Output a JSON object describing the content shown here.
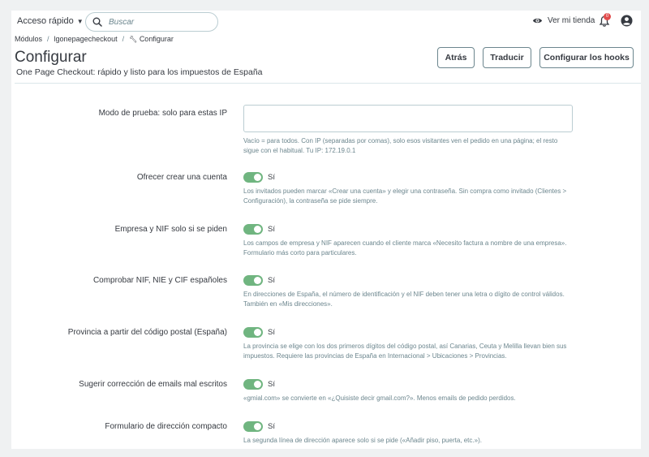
{
  "topbar": {
    "quick_access": "Acceso rápido",
    "search_placeholder": "Buscar",
    "store_link": "Ver mi tienda",
    "notification_count": "0"
  },
  "breadcrumb": {
    "items": [
      "Módulos",
      "lgonepagecheckout",
      "Configurar"
    ]
  },
  "header": {
    "title": "Configurar",
    "subtitle": "One Page Checkout: rápido y listo para los impuestos de España",
    "buttons": {
      "back": "Atrás",
      "translate": "Traducir",
      "hooks": "Configurar los hooks"
    }
  },
  "form": {
    "test_mode": {
      "label": "Modo de prueba: solo para estas IP",
      "value": "",
      "help": "Vacío = para todos. Con IP (separadas por comas), solo esos visitantes ven el pedido en una página; el resto sigue con el habitual. Tu IP: 172.19.0.1"
    },
    "options": [
      {
        "label": "Ofrecer crear una cuenta",
        "state": "Sí",
        "help": "Los invitados pueden marcar «Crear una cuenta» y elegir una contraseña. Sin compra como invitado (Clientes > Configuración), la contraseña se pide siempre."
      },
      {
        "label": "Empresa y NIF solo si se piden",
        "state": "Sí",
        "help": "Los campos de empresa y NIF aparecen cuando el cliente marca «Necesito factura a nombre de una empresa». Formulario más corto para particulares."
      },
      {
        "label": "Comprobar NIF, NIE y CIF españoles",
        "state": "Sí",
        "help": "En direcciones de España, el número de identificación y el NIF deben tener una letra o dígito de control válidos. También en «Mis direcciones»."
      },
      {
        "label": "Provincia a partir del código postal (España)",
        "state": "Sí",
        "help": "La provincia se elige con los dos primeros dígitos del código postal, así Canarias, Ceuta y Melilla llevan bien sus impuestos. Requiere las provincias de España en Internacional > Ubicaciones > Provincias."
      },
      {
        "label": "Sugerir corrección de emails mal escritos",
        "state": "Sí",
        "help": "«gmial.com» se convierte en «¿Quisiste decir gmail.com?». Menos emails de pedido perdidos."
      },
      {
        "label": "Formulario de dirección compacto",
        "state": "Sí",
        "help": "La segunda línea de dirección aparece solo si se pide («Añadir piso, puerta, etc.»)."
      }
    ]
  }
}
